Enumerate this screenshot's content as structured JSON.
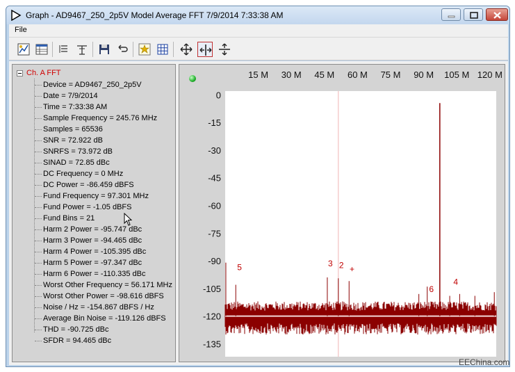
{
  "window": {
    "title": "Graph - AD9467_250_2p5V Model Average FFT 7/9/2014 7:33:38 AM",
    "icon": "play-triangle-icon"
  },
  "menu": {
    "file_label": "File"
  },
  "toolbar": {
    "icons": [
      "chart-properties-icon",
      "table-icon",
      "list-icon",
      "marker-icon",
      "save-icon",
      "undo-icon",
      "fft-settings-icon",
      "grid-icon",
      "zoom-xy-icon",
      "zoom-x-icon",
      "zoom-y-icon"
    ],
    "active": "zoom-x-icon"
  },
  "tree": {
    "root_label": "Ch. A FFT",
    "items": [
      "Device = AD9467_250_2p5V",
      "Date = 7/9/2014",
      "Time = 7:33:38 AM",
      "Sample Frequency = 245.76 MHz",
      "Samples = 65536",
      "SNR = 72.922 dB",
      "SNRFS = 73.972 dB",
      "SINAD = 72.85 dBc",
      "DC Frequency = 0 MHz",
      "DC Power = -86.459 dBFS",
      "Fund Frequency = 97.301 MHz",
      "Fund Power = -1.05 dBFS",
      "Fund Bins = 21",
      "Harm 2 Power = -95.747 dBc",
      "Harm 3 Power = -94.465 dBc",
      "Harm 4 Power = -105.395 dBc",
      "Harm 5 Power = -97.347 dBc",
      "Harm 6 Power = -110.335 dBc",
      "Worst Other Frequency = 56.171 MHz",
      "Worst Other Power = -98.616 dBFS",
      "Noise / Hz = -154.867 dBFS / Hz",
      "Average Bin Noise = -119.126 dBFS",
      "THD = -90.725 dBc",
      "SFDR = 94.465 dBc"
    ]
  },
  "plot": {
    "status_color": "#1fb02a",
    "trace_color": "#8b0000",
    "annotation_color": "#c00000"
  },
  "chart_data": {
    "type": "line",
    "x_unit": "MHz",
    "xlim": [
      0,
      122.88
    ],
    "ylim": [
      -142,
      2
    ],
    "x_ticks": [
      15,
      30,
      45,
      60,
      75,
      90,
      105,
      120
    ],
    "x_tick_labels": [
      "15 M",
      "30 M",
      "45 M",
      "60 M",
      "75 M",
      "90 M",
      "105 M",
      "120 M"
    ],
    "y_ticks": [
      0,
      -15,
      -30,
      -45,
      -60,
      -75,
      -90,
      -105,
      -120,
      -135
    ],
    "y_tick_labels": [
      "0",
      "-15",
      "-30",
      "-45",
      "-60",
      "-75",
      "-90",
      "-105",
      "-120",
      "-135"
    ],
    "noise_floor": -120,
    "fundamental": {
      "x": 97.301,
      "y": -4.5
    },
    "spurs": [
      {
        "x": 0.3,
        "y": -91
      },
      {
        "x": 4.8,
        "y": -103
      },
      {
        "x": 46.3,
        "y": -99
      },
      {
        "x": 51.3,
        "y": -99.5
      },
      {
        "x": 56.171,
        "y": -101
      },
      {
        "x": 87.8,
        "y": -108
      },
      {
        "x": 91.6,
        "y": -104
      },
      {
        "x": 101.8,
        "y": -109
      },
      {
        "x": 106.3,
        "y": -108
      },
      {
        "x": 113.2,
        "y": -109
      },
      {
        "x": 122.0,
        "y": -107
      }
    ],
    "annotations": [
      {
        "label": "5",
        "x": 6.5,
        "y": -95
      },
      {
        "label": "3",
        "x": 47.7,
        "y": -93
      },
      {
        "label": "2",
        "x": 52.7,
        "y": -94
      },
      {
        "label": "+",
        "x": 57.5,
        "y": -96
      },
      {
        "label": "6",
        "x": 93.5,
        "y": -107
      },
      {
        "label": "4",
        "x": 104.5,
        "y": -103
      }
    ],
    "marker_x": 51.3
  },
  "watermark": "EEChina.com"
}
